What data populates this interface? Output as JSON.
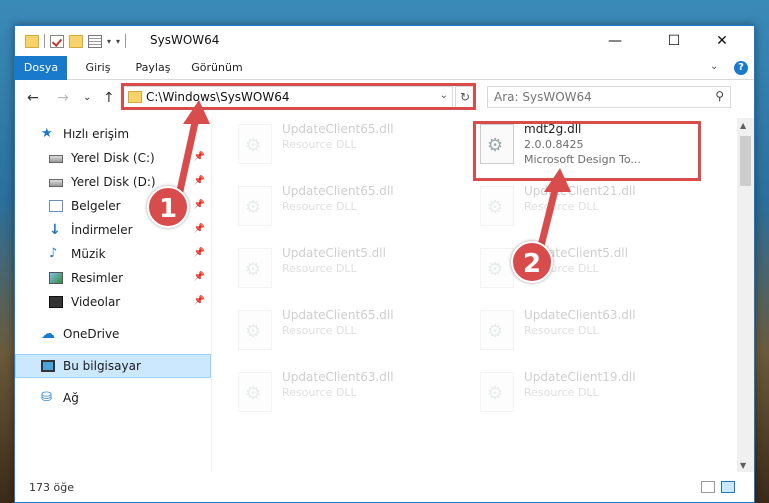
{
  "window": {
    "title": "SysWOW64",
    "controls": {
      "minimize": "—",
      "maximize": "☐",
      "close": "✕"
    }
  },
  "ribbon": {
    "tabs": [
      "Dosya",
      "Giriş",
      "Paylaş",
      "Görünüm"
    ],
    "active_tab": "Dosya",
    "help": "?",
    "expand": "⌄"
  },
  "nav": {
    "back": "←",
    "forward": "→",
    "recent": "⌄",
    "up": "↑",
    "address": "C:\\Windows\\SysWOW64",
    "refresh": "↻",
    "search_placeholder": "Ara: SysWOW64"
  },
  "sidebar": {
    "items": [
      {
        "label": "Hızlı erişim",
        "icon": "star-icon",
        "pinned": false
      },
      {
        "label": "Yerel Disk (C:)",
        "icon": "disk-icon",
        "pinned": true
      },
      {
        "label": "Yerel Disk (D:)",
        "icon": "disk-icon",
        "pinned": true
      },
      {
        "label": "Belgeler",
        "icon": "documents-icon",
        "pinned": true
      },
      {
        "label": "İndirmeler",
        "icon": "downloads-icon",
        "pinned": true
      },
      {
        "label": "Müzik",
        "icon": "music-icon",
        "pinned": true
      },
      {
        "label": "Resimler",
        "icon": "pictures-icon",
        "pinned": true
      },
      {
        "label": "Videolar",
        "icon": "videos-icon",
        "pinned": true
      },
      {
        "label": "OneDrive",
        "icon": "cloud-icon",
        "pinned": false
      },
      {
        "label": "Bu bilgisayar",
        "icon": "computer-icon",
        "pinned": false,
        "selected": true
      },
      {
        "label": "Ağ",
        "icon": "network-icon",
        "pinned": false
      }
    ],
    "pin_glyph": "📌"
  },
  "files": {
    "left": [
      {
        "name": "UpdateClient65.dll",
        "type": "Resource DLL"
      },
      {
        "name": "UpdateClient65.dll",
        "type": "Resource DLL"
      },
      {
        "name": "UpdateClient5.dll",
        "type": "Resource DLL"
      },
      {
        "name": "UpdateClient65.dll",
        "type": "Resource DLL"
      },
      {
        "name": "UpdateClient63.dll",
        "type": "Resource DLL"
      }
    ],
    "right": [
      {
        "name": "mdt2g.dll",
        "version": "2.0.0.8425",
        "desc": "Microsoft Design To...",
        "highlight": true
      },
      {
        "name": "UpdateClient21.dll",
        "type": "Resource DLL"
      },
      {
        "name": "UpdateClient5.dll",
        "type": "Resource DLL"
      },
      {
        "name": "UpdateClient63.dll",
        "type": "Resource DLL"
      },
      {
        "name": "UpdateClient19.dll",
        "type": "Resource DLL"
      }
    ]
  },
  "status": {
    "count": "173 öğe"
  },
  "callouts": {
    "one": "1",
    "two": "2"
  },
  "colors": {
    "accent": "#1979ca",
    "highlight": "#d94c4c"
  }
}
